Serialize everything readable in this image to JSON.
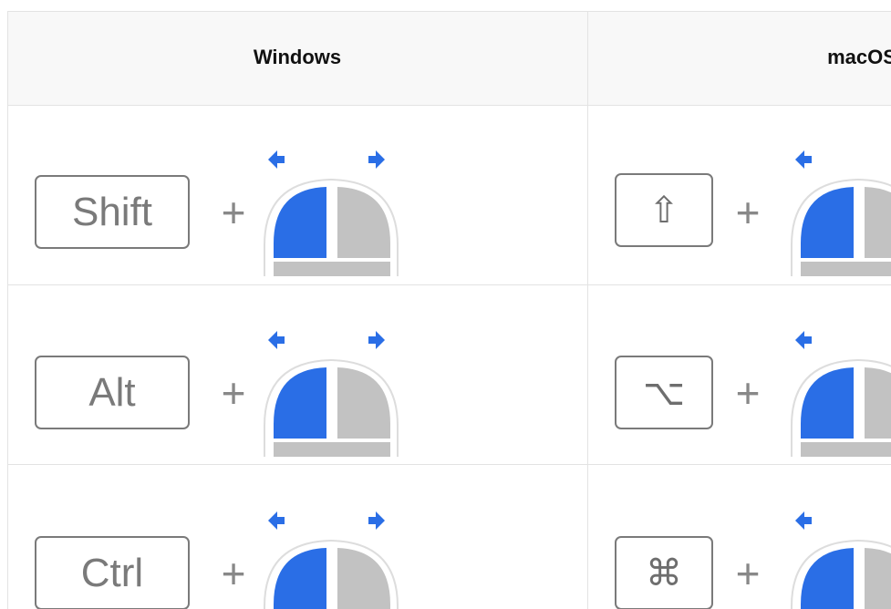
{
  "table": {
    "headers": {
      "windows": "Windows",
      "macos": "macOS"
    },
    "plus_glyph": "+",
    "rows": [
      {
        "windows_key": "Shift",
        "macos_key": "⇧",
        "macos_key_name": "shift-key-icon"
      },
      {
        "windows_key": "Alt",
        "macos_key": "⌥",
        "macos_key_name": "option-key-icon"
      },
      {
        "windows_key": "Ctrl",
        "macos_key": "⌘",
        "macos_key_name": "command-key-icon"
      }
    ]
  },
  "colors": {
    "accent_blue": "#2a6ee6",
    "mouse_gray": "#c2c2c2",
    "key_border": "#7a7a7a",
    "header_bg": "#f8f8f8",
    "grid_line": "#e3e3e3"
  },
  "icons": [
    "mouse-scroll-icon",
    "arrow-left-icon",
    "arrow-right-icon"
  ]
}
